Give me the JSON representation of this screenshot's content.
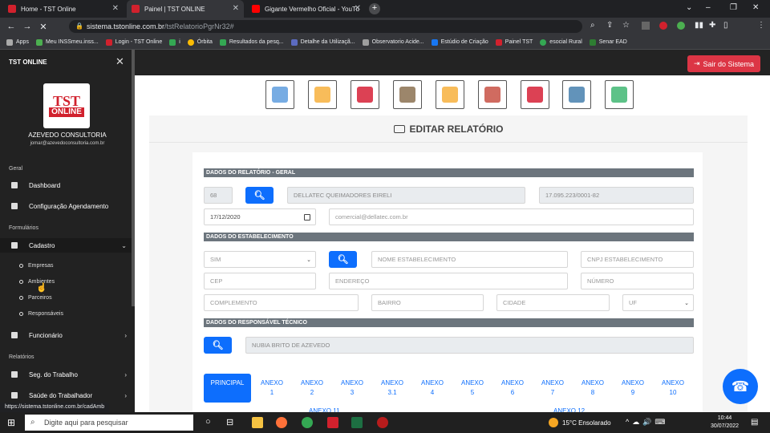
{
  "browser": {
    "tabs": [
      {
        "title": "Home - TST Online",
        "color": "#d1212d",
        "active": false
      },
      {
        "title": "Painel | TST ONLINE",
        "color": "#d1212d",
        "active": true
      },
      {
        "title": "Gigante Vermelho Oficial - YouTu",
        "color": "#ff0000",
        "active": false
      }
    ],
    "url_host": "sistema.tstonline.com.br",
    "url_path": "/tstRelatorioPgrNr32#",
    "bookmarks": [
      "Apps",
      "Meu INSSmeu.inss...",
      "Login - TST Online",
      "i",
      "Órbita",
      "Resultados da pesq...",
      "Detalhe da Utilizaçã...",
      "Observatorio Acide...",
      "Estúdio de Criação",
      "Painel TST",
      "esocial Rural",
      "Senar EAD"
    ],
    "bookmarks_more": "»",
    "status_url": "https://sistema.tstonline.com.br/cadAmb"
  },
  "sidebar": {
    "header": "TST ONLINE",
    "logo_top": "TST",
    "logo_bottom": "ONLINE",
    "company": "AZEVEDO CONSULTORIA",
    "email": "jomar@azevedoconsultoria.com.br",
    "section_geral": "Geral",
    "dashboard": "Dashboard",
    "config": "Configuração Agendamento",
    "section_form": "Formulários",
    "cadastro": "Cadastro",
    "sub": [
      "Empresas",
      "Ambientes",
      "Parceiros",
      "Responsáveis"
    ],
    "funcionario": "Funcionário",
    "section_rel": "Relatórios",
    "seg": "Seg. do Trabalho",
    "saude": "Saúde do Trabalhador"
  },
  "header": {
    "logout": "Sair do Sistema"
  },
  "menu_icons": [
    "building-icon",
    "helmet-icon",
    "first-aid-kit-icon",
    "worker-icon",
    "folder-icon",
    "clipboard-icon",
    "medical-report-icon",
    "doctor-icon",
    "care-hands-icon"
  ],
  "menu_colors": [
    "#4a90d9",
    "#f5a623",
    "#d0021b",
    "#7b5e3a",
    "#f5a623",
    "#c0392b",
    "#d0021b",
    "#2d6fa3",
    "#27ae60"
  ],
  "page": {
    "title": "EDITAR RELATÓRIO"
  },
  "form": {
    "sec1": "DADOS DO RELATÓRIO - GERAL",
    "id": "68",
    "empresa": "DELLATEC QUEIMADORES EIRELI",
    "cnpj": "17.095.223/0001-82",
    "data": "17/12/2020",
    "email": "comercial@dellatec.com.br",
    "sec2": "DADOS DO ESTABELECIMENTO",
    "sim": "SIM",
    "nome_est": "NOME ESTABELECIMENTO",
    "cnpj_est": "CNPJ ESTABELECIMENTO",
    "cep": "CEP",
    "endereco": "ENDEREÇO",
    "numero": "NÚMERO",
    "complemento": "COMPLEMENTO",
    "bairro": "BAIRRO",
    "cidade": "CIDADE",
    "uf": "UF",
    "sec3": "DADOS DO RESPONSÁVEL TÉCNICO",
    "responsavel": "NUBIA BRITO DE AZEVEDO"
  },
  "tabs": [
    {
      "l1": "PRINCIPAL",
      "l2": ""
    },
    {
      "l1": "ANEXO",
      "l2": "1"
    },
    {
      "l1": "ANEXO",
      "l2": "2"
    },
    {
      "l1": "ANEXO",
      "l2": "3"
    },
    {
      "l1": "ANEXO",
      "l2": "3.1"
    },
    {
      "l1": "ANEXO",
      "l2": "4"
    },
    {
      "l1": "ANEXO",
      "l2": "5"
    },
    {
      "l1": "ANEXO",
      "l2": "6"
    },
    {
      "l1": "ANEXO",
      "l2": "7"
    },
    {
      "l1": "ANEXO",
      "l2": "8"
    },
    {
      "l1": "ANEXO",
      "l2": "9"
    },
    {
      "l1": "ANEXO",
      "l2": "10"
    }
  ],
  "tabs_row2": [
    "ANEXO 11",
    "ANEXO 12"
  ],
  "taskbar": {
    "search": "Digite aqui para pesquisar",
    "weather": "15°C Ensolarado",
    "time": "10:44",
    "date": "30/07/2022"
  }
}
